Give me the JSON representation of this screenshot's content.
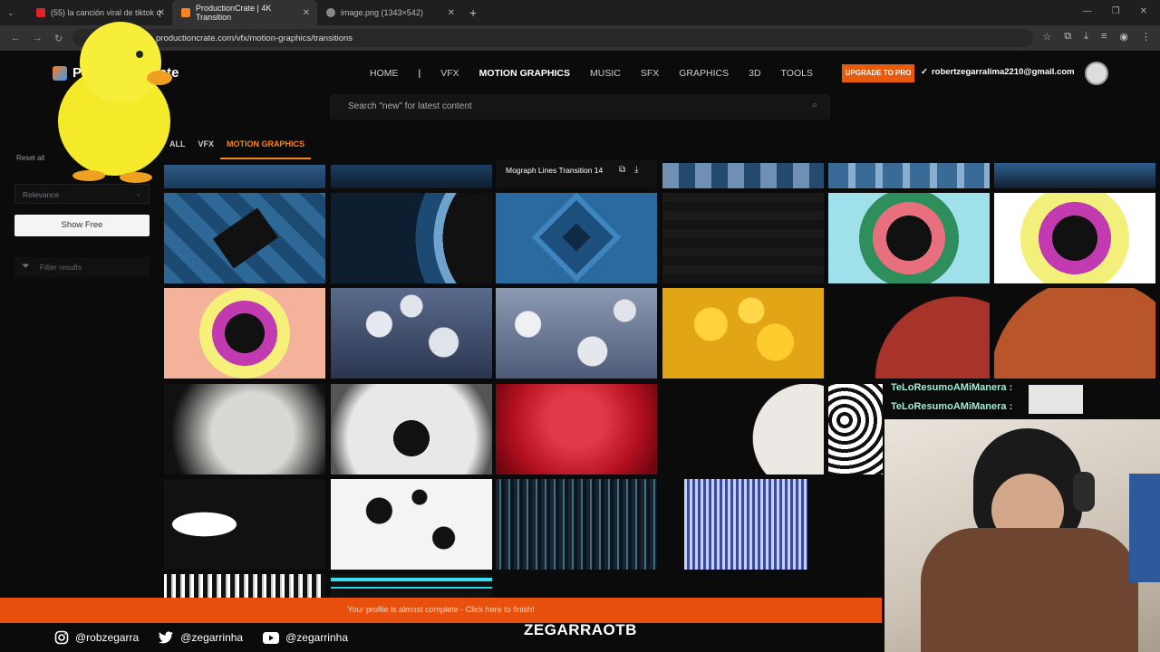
{
  "browser": {
    "tabs": [
      {
        "label": "(55) la canción viral de tiktok q",
        "fav": "#e2222b"
      },
      {
        "label": "ProductionCrate | 4K Transition",
        "fav": "#f7851f"
      },
      {
        "label": "image.png (1343×542)",
        "fav": "#888888"
      }
    ],
    "url": "productioncrate.com/vfx/motion-graphics/transitions"
  },
  "site": {
    "logo": "ProductionCrate",
    "nav": [
      "HOME",
      "VFX",
      "MOTION GRAPHICS",
      "MUSIC",
      "SFX",
      "GRAPHICS",
      "3D",
      "TOOLS"
    ],
    "nav_separator": "|",
    "upgrade": "UPGRADE TO PRO",
    "email": "robertzegarralima2210@gmail.com",
    "search_placeholder": "Search \"new\" for latest content"
  },
  "sidebar": {
    "reset": "Reset all",
    "sort": "Relevance",
    "show_free": "Show Free",
    "filter_placeholder": "Filter results"
  },
  "categories": [
    "ALL",
    "VFX",
    "MOTION GRAPHICS"
  ],
  "hovered_item": "Mograph Lines Transition 14",
  "banner": "Your profile is almost complete - Click here to finish!",
  "stream": {
    "name": "ZEGARRAOTB",
    "chat": [
      "TeLoResumoAMiManera :",
      "TeLoResumoAMiManera :"
    ],
    "socials": [
      {
        "icon": "instagram-icon",
        "handle": "@robzegarra"
      },
      {
        "icon": "twitter-icon",
        "handle": "@zegarrinha"
      },
      {
        "icon": "youtube-icon",
        "handle": "@zegarrinha"
      }
    ]
  },
  "colors": {
    "accent": "#f7851f",
    "banner": "#e8500e",
    "upgrade": "#e85a0c"
  }
}
